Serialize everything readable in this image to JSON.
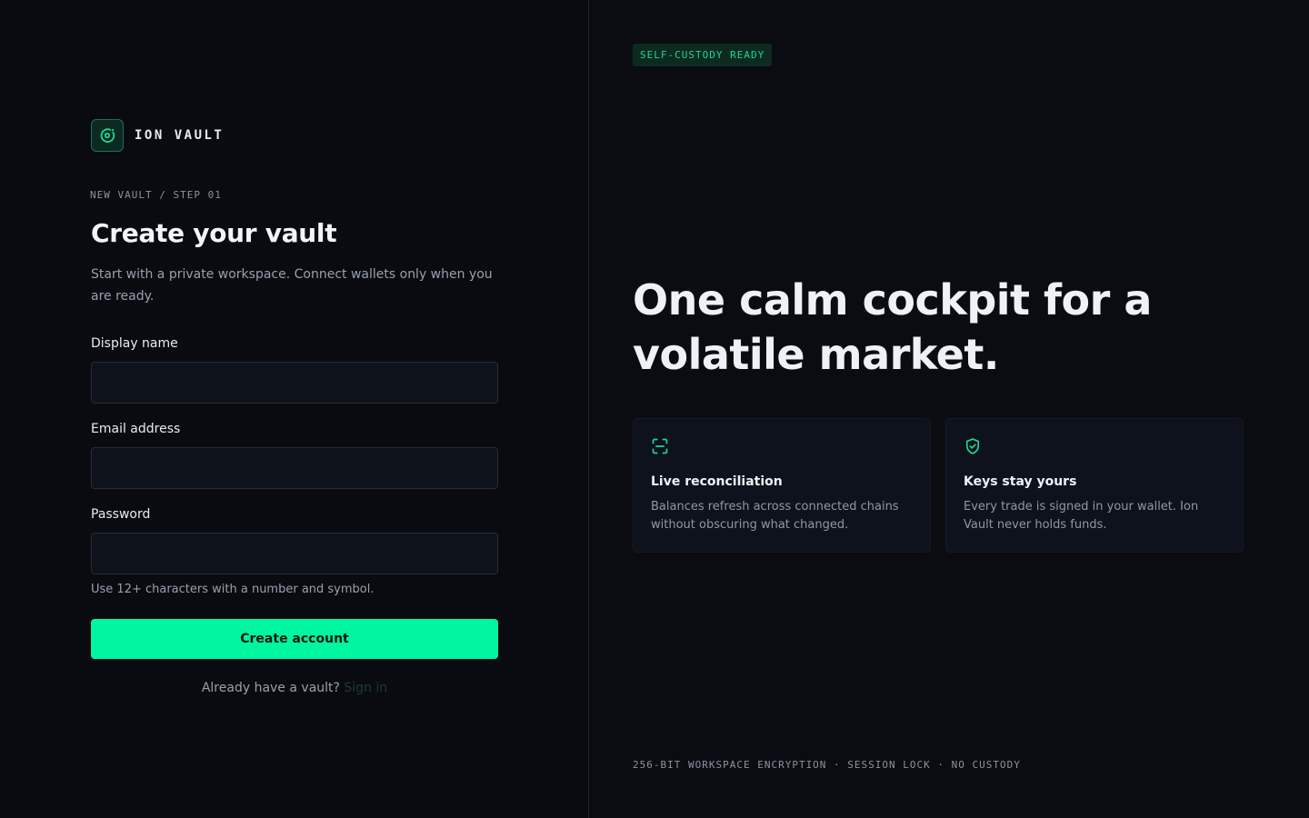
{
  "brand": {
    "name": "ION VAULT",
    "logo_icon": "orbit-icon",
    "accent": "#00f5a0"
  },
  "form": {
    "step": "NEW VAULT / STEP 01",
    "title": "Create your vault",
    "subtitle": "Start with a private workspace. Connect wallets only when you are ready.",
    "fields": [
      {
        "label": "Display name",
        "value": "",
        "placeholder": ""
      },
      {
        "label": "Email address",
        "value": "",
        "placeholder": ""
      },
      {
        "label": "Password",
        "value": "",
        "placeholder": ""
      }
    ],
    "password_hint": "Use 12+ characters with a number and symbol.",
    "submit_label": "Create account",
    "signin_prompt": "Already have a vault?",
    "signin_link": "Sign in"
  },
  "promo": {
    "badge": "SELF-CUSTODY READY",
    "headline": "One calm cockpit for a volatile market.",
    "cards": [
      {
        "icon": "scan-icon",
        "title": "Live reconciliation",
        "text": "Balances refresh across connected chains without obscuring what changed."
      },
      {
        "icon": "shield-check-icon",
        "title": "Keys stay yours",
        "text": "Every trade is signed in your wallet. Ion Vault never holds funds."
      }
    ],
    "footer": "256-BIT WORKSPACE ENCRYPTION · SESSION LOCK · NO CUSTODY"
  }
}
